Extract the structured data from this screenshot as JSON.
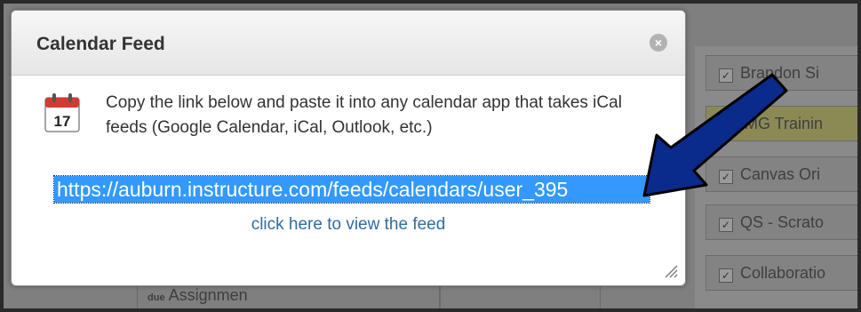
{
  "dialog": {
    "title": "Calendar Feed",
    "close_icon": "×",
    "calendar_icon_day": "17",
    "description": "Copy the link below and paste it into any calendar app that takes iCal feeds (Google Calendar, iCal, Outlook, etc.)",
    "feed_url": "https://auburn.instructure.com/feeds/calendars/user_395",
    "view_feed_label": "click here to view the feed"
  },
  "background": {
    "calendar_items": [
      {
        "label": "Brandon Si",
        "checked": true
      },
      {
        "label": "IMG Trainin",
        "checked": false
      },
      {
        "label": "Canvas Ori",
        "checked": true
      },
      {
        "label": "QS - Scrato",
        "checked": true
      },
      {
        "label": "Collaboratio",
        "checked": true
      }
    ],
    "assignment_badge": "due",
    "assignment_label": "Assignmen"
  },
  "colors": {
    "selection": "#3399ff",
    "link": "#2f6ca0",
    "annotation_arrow": "#0a2a8c"
  }
}
